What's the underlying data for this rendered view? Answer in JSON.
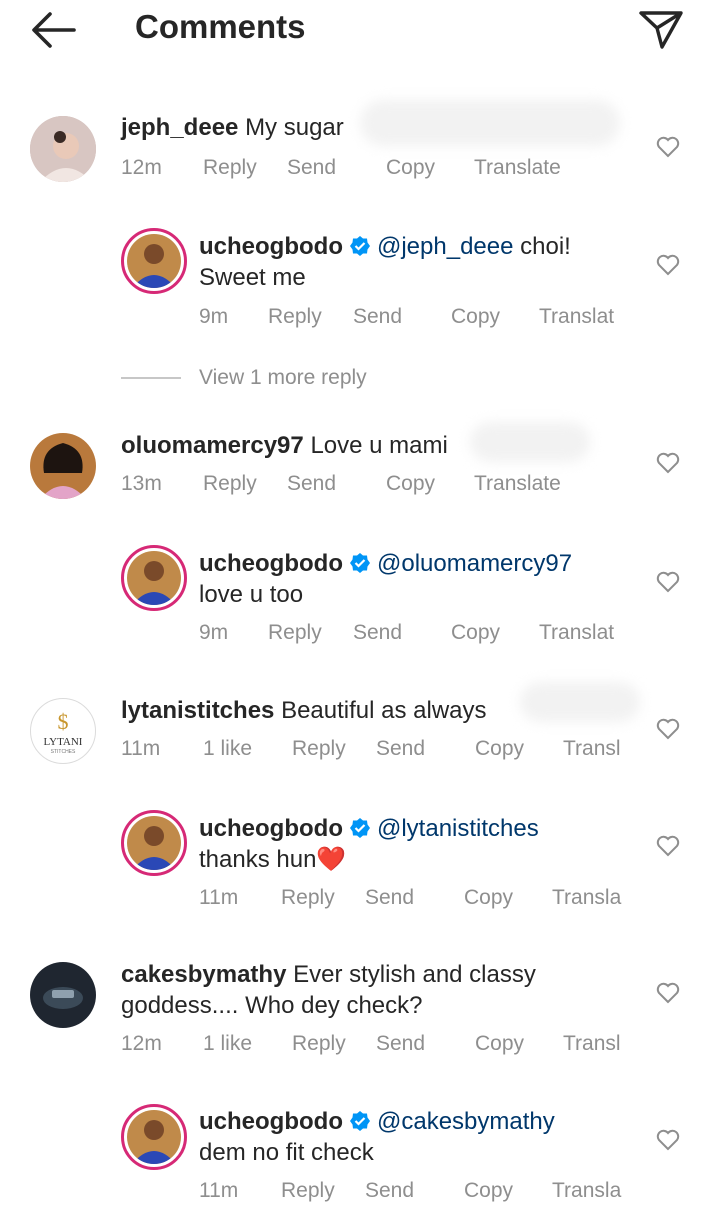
{
  "header": {
    "title": "Comments",
    "back_icon": "back-arrow-icon",
    "send_icon": "direct-send-icon"
  },
  "colors": {
    "mention": "#00376b",
    "meta": "#8e8e8e",
    "verified": "#0095f6",
    "ring": "#d62976"
  },
  "comments": [
    {
      "user": "jeph_deee",
      "text": "My sugar",
      "time": "12m",
      "likes": "",
      "actions": [
        "Reply",
        "Send",
        "Copy",
        "Translate"
      ]
    },
    {
      "user": "ucheogbodo",
      "verified": true,
      "mention": "@jeph_deee",
      "text": "choi!",
      "text2": "Sweet me",
      "time": "9m",
      "actions": [
        "Reply",
        "Send",
        "Copy",
        "Translat"
      ]
    },
    {
      "user": "oluomamercy97",
      "text": "Love u mami",
      "time": "13m",
      "actions": [
        "Reply",
        "Send",
        "Copy",
        "Translate"
      ]
    },
    {
      "user": "ucheogbodo",
      "verified": true,
      "mention": "@oluomamercy97",
      "text2": "love u too",
      "time": "9m",
      "actions": [
        "Reply",
        "Send",
        "Copy",
        "Translat"
      ]
    },
    {
      "user": "lytanistitches",
      "text": "Beautiful as always",
      "time": "11m",
      "likes": "1 like",
      "actions": [
        "Reply",
        "Send",
        "Copy",
        "Transl"
      ]
    },
    {
      "user": "ucheogbodo",
      "verified": true,
      "mention": "@lytanistitches",
      "text2": "thanks hun❤️",
      "time": "11m",
      "actions": [
        "Reply",
        "Send",
        "Copy",
        "Transla"
      ]
    },
    {
      "user": "cakesbymathy",
      "text": "Ever stylish and classy",
      "text2": "goddess.... Who dey check?",
      "time": "12m",
      "likes": "1 like",
      "actions": [
        "Reply",
        "Send",
        "Copy",
        "Transl"
      ]
    },
    {
      "user": "ucheogbodo",
      "verified": true,
      "mention": "@cakesbymathy",
      "text2": "dem no fit check",
      "time": "11m",
      "actions": [
        "Reply",
        "Send",
        "Copy",
        "Transla"
      ]
    }
  ],
  "view_more": "View 1 more reply",
  "lytani_logo": "LYTANI STITCHES"
}
